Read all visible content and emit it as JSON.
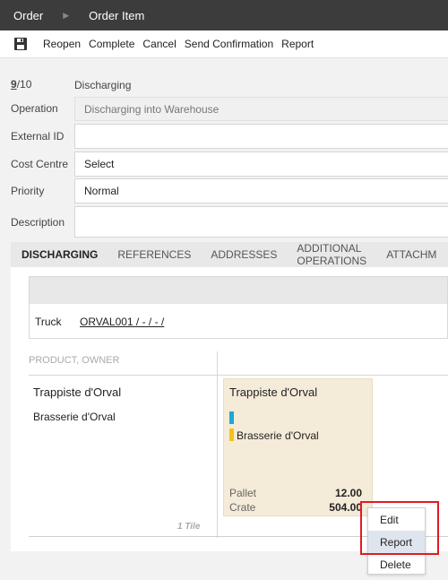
{
  "topbar": {
    "crumb1": "Order",
    "crumb2": "Order Item"
  },
  "toolbar": {
    "buttons": [
      "Reopen",
      "Complete",
      "Cancel",
      "Send Confirmation",
      "Report"
    ]
  },
  "form": {
    "step_prefix": "9",
    "step_suffix": "/10",
    "step_label": "Discharging",
    "operation_label": "Operation",
    "operation_value": "Discharging into Warehouse",
    "external_id_label": "External ID",
    "external_id_value": "",
    "cost_centre_label": "Cost Centre",
    "cost_centre_value": "Select",
    "priority_label": "Priority",
    "priority_value": "Normal",
    "description_label": "Description",
    "description_value": ""
  },
  "tabs": [
    "DISCHARGING",
    "REFERENCES",
    "ADDRESSES",
    "ADDITIONAL OPERATIONS",
    "ATTACHM"
  ],
  "transport": {
    "label": "Truck",
    "link": "ORVAL001 / - / - /"
  },
  "grid": {
    "header": "PRODUCT, OWNER",
    "product": "Trappiste d'Orval",
    "owner": "Brasserie d'Orval",
    "tile_count": "1 Tile"
  },
  "tile": {
    "name": "Trappiste d'Orval",
    "owner": "Brasserie d'Orval",
    "quantities": [
      {
        "unit": "Pallet",
        "value": "12.00"
      },
      {
        "unit": "Crate",
        "value": "504.00"
      }
    ],
    "bar_colors": [
      "#1ea7d8",
      "#f2c314"
    ]
  },
  "context_menu": {
    "items": [
      "Edit",
      "Report",
      "Delete"
    ],
    "highlighted": "Report"
  }
}
